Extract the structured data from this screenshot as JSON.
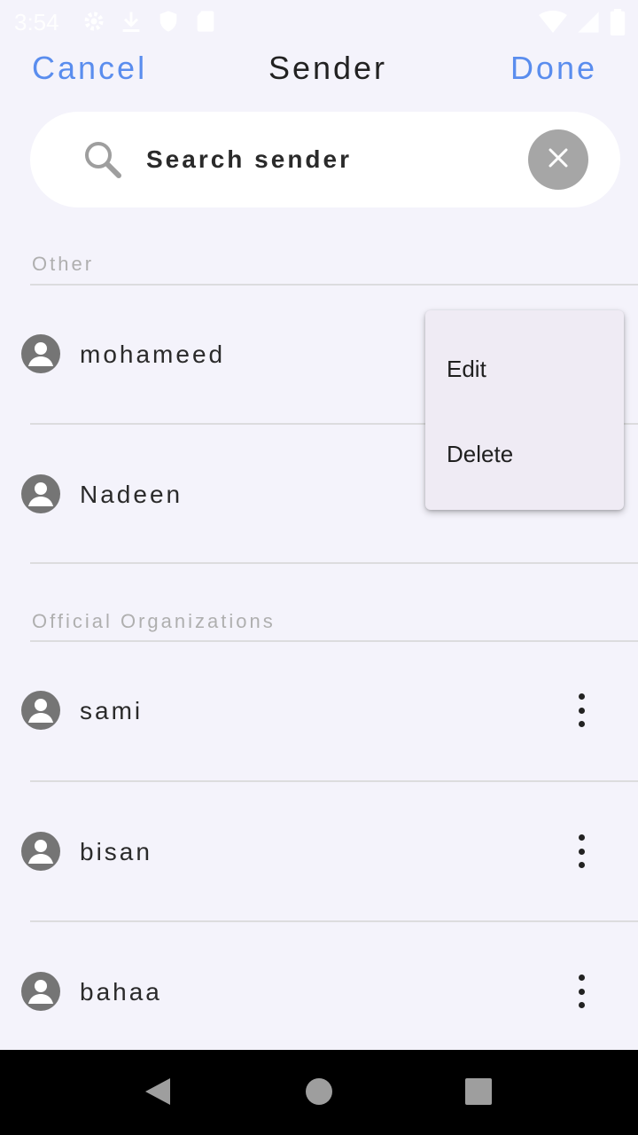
{
  "status_bar": {
    "time": "3:54",
    "icons": [
      "settings-icon",
      "download-icon",
      "shield-icon",
      "sd-card-icon",
      "wifi-icon",
      "signal-icon",
      "battery-icon"
    ]
  },
  "header": {
    "cancel_label": "Cancel",
    "title": "Sender",
    "done_label": "Done"
  },
  "search": {
    "placeholder": "Search sender"
  },
  "sections": [
    {
      "title": "Other",
      "items": [
        {
          "name": "mohameed"
        },
        {
          "name": "Nadeen"
        }
      ]
    },
    {
      "title": "Official Organizations",
      "items": [
        {
          "name": "sami"
        },
        {
          "name": "bisan"
        },
        {
          "name": "bahaa"
        }
      ]
    }
  ],
  "popup_menu": {
    "items": [
      "Edit",
      "Delete"
    ]
  },
  "colors": {
    "accent": "#5A8DEE",
    "background": "#F4F3FB",
    "menu_background": "#EFEBF4"
  }
}
